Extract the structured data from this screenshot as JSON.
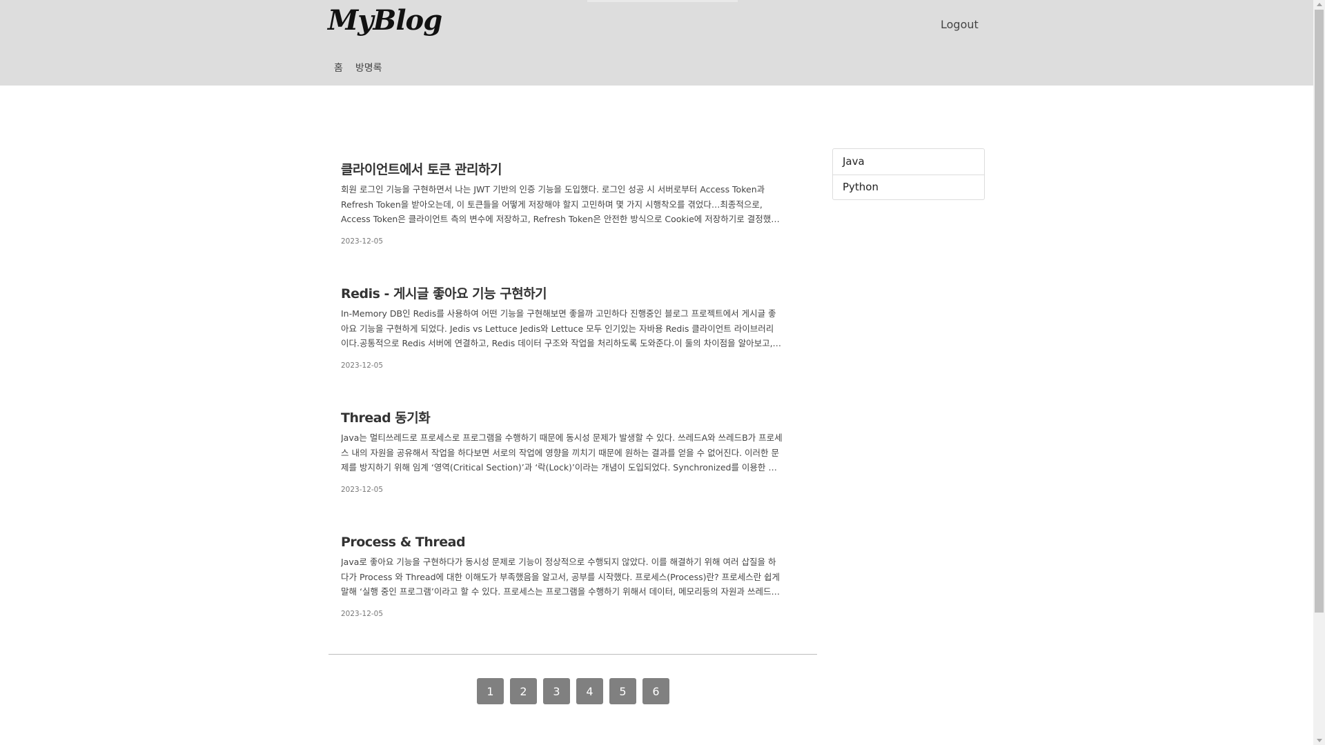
{
  "header": {
    "logo": "MyBlog",
    "logout_label": "Logout",
    "nav": [
      {
        "label": "홈"
      },
      {
        "label": "방명록"
      }
    ]
  },
  "posts": [
    {
      "title": "클라이언트에서 토큰 관리하기",
      "excerpt": "회원 로그인 기능을 구현하면서 나는 JWT 기반의 인증 기능을 도입했다. 로그인 성공 시 서버로부터 Access Token과 Refresh Token을 받아오는데, 이 토큰들을 어떻게 저장해야 할지 고민하며 몇 가지 시행착오를 겪었다…최종적으로, Access Token은 클라이언트 측의 변수에 저장하고, Refresh Token은 안전한 방식으로 Cookie에 저장하기로 결정했다. …",
      "date": "2023-12-05"
    },
    {
      "title": "Redis - 게시글 좋아요 기능 구현하기",
      "excerpt": "In-Memory DB인 Redis를 사용하여 어떤 기능을 구현해보면 좋을까 고민하다 진행중인 블로그 프로젝트에서 게시글 좋아요 기능을 구현하게 되었다. Jedis vs Lettuce Jedis와 Lettuce 모두 인기있는 자바용 Redis 클라이언트 라이브러리 이다.공통적으로 Redis 서버에 연결하고, Redis 데이터 구조와 작업을 처리하도록 도와준다.이 둘의 차이점을 알아보고, 현재 프로젝…",
      "date": "2023-12-05"
    },
    {
      "title": "Thread 동기화",
      "excerpt": "Java는 멀티쓰레드로 프로세스로 프로그램을 수행하기 때문에 동시성 문제가 발생할 수 있다. 쓰레드A와 쓰레드B가 프로세스 내의 자원을 공유해서 작업을 하다보면 서로의 작업에 영향을 끼치기 때문에 원하는 결과를 얻을 수 없어진다. 이러한 문제를 방지하기 위해 임계 ‘영역(Critical Section)’과 ‘락(Lock)’이라는 개념이 도입되었다. Synchronized를 이용한 동기화…",
      "date": "2023-12-05"
    },
    {
      "title": "Process & Thread",
      "excerpt": "Java로 좋아요 기능을 구현하다가 동시성 문제로 기능이 정상적으로 수행되지 않았다. 이를 해결하기 위해 여러 삽질을 하다가 Process 와 Thread에 대한 이해도가 부족했음을 알고서, 공부를 시작했다. 프로세스(Process)란? 프로세스란 쉽게 말해 ‘실행 중인 프로그램’이라고 할 수 있다. 프로세스는 프로그램을 수행하기 위해서 데이터, 메모리등의 자원과 쓰레드로 구성…",
      "date": "2023-12-05"
    }
  ],
  "pagination": [
    "1",
    "2",
    "3",
    "4",
    "5",
    "6"
  ],
  "categories": [
    {
      "label": "Java"
    },
    {
      "label": "Python"
    }
  ]
}
